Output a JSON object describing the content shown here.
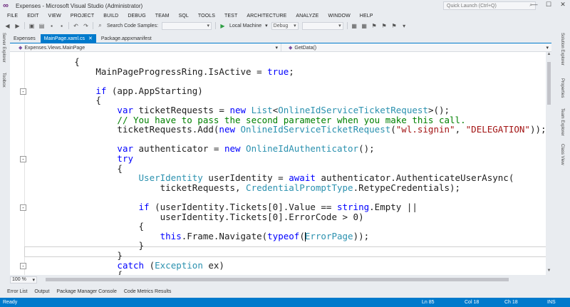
{
  "window": {
    "title": "Expenses - Microsoft Visual Studio (Administrator)",
    "quick_launch_placeholder": "Quick Launch (Ctrl+Q)",
    "min": "—",
    "max": "☐",
    "close": "✕"
  },
  "menu": [
    "FILE",
    "EDIT",
    "VIEW",
    "PROJECT",
    "BUILD",
    "DEBUG",
    "TEAM",
    "SQL",
    "TOOLS",
    "TEST",
    "ARCHITECTURE",
    "ANALYZE",
    "WINDOW",
    "HELP"
  ],
  "toolbar": {
    "search_code_samples": "Search Code Samples:",
    "run_target": "Local Machine",
    "configuration": "Debug"
  },
  "doc_tabs": [
    {
      "label": "Expenses",
      "active": false
    },
    {
      "label": "MainPage.xaml.cs",
      "active": true
    },
    {
      "label": "Package.appxmanifest",
      "active": false
    }
  ],
  "navbar": {
    "type_scope": "Expenses.Views.MainPage",
    "member_scope": "GetData()"
  },
  "side_tools": {
    "left": [
      "Server Explorer",
      "Toolbox"
    ],
    "right": [
      "Solution Explorer",
      "Properties",
      "Team Explorer",
      "Class View"
    ]
  },
  "code": {
    "lines": [
      {
        "indent": "        ",
        "parts": [
          {
            "t": "{",
            "c": ""
          }
        ]
      },
      {
        "indent": "            ",
        "parts": [
          {
            "t": "MainPageProgressRing.IsActive = ",
            "c": ""
          },
          {
            "t": "true",
            "c": "kw"
          },
          {
            "t": ";",
            "c": ""
          }
        ]
      },
      {
        "indent": "",
        "parts": [
          {
            "t": "",
            "c": ""
          }
        ]
      },
      {
        "indent": "            ",
        "parts": [
          {
            "t": "if",
            "c": "kw"
          },
          {
            "t": " (app.AppStarting)",
            "c": ""
          }
        ]
      },
      {
        "indent": "            ",
        "parts": [
          {
            "t": "{",
            "c": ""
          }
        ]
      },
      {
        "indent": "                ",
        "parts": [
          {
            "t": "var",
            "c": "kw"
          },
          {
            "t": " ticketRequests = ",
            "c": ""
          },
          {
            "t": "new",
            "c": "kw"
          },
          {
            "t": " ",
            "c": ""
          },
          {
            "t": "List",
            "c": "ty"
          },
          {
            "t": "<",
            "c": ""
          },
          {
            "t": "OnlineIdServiceTicketRequest",
            "c": "ty"
          },
          {
            "t": ">();",
            "c": ""
          }
        ]
      },
      {
        "indent": "                ",
        "parts": [
          {
            "t": "// You have to pass the second parameter when you make this call.",
            "c": "cm"
          }
        ]
      },
      {
        "indent": "                ",
        "parts": [
          {
            "t": "ticketRequests.Add(",
            "c": ""
          },
          {
            "t": "new",
            "c": "kw"
          },
          {
            "t": " ",
            "c": ""
          },
          {
            "t": "OnlineIdServiceTicketRequest",
            "c": "ty"
          },
          {
            "t": "(",
            "c": ""
          },
          {
            "t": "\"wl.signin\"",
            "c": "str"
          },
          {
            "t": ", ",
            "c": ""
          },
          {
            "t": "\"DELEGATION\"",
            "c": "str"
          },
          {
            "t": "));",
            "c": ""
          }
        ]
      },
      {
        "indent": "",
        "parts": [
          {
            "t": "",
            "c": ""
          }
        ]
      },
      {
        "indent": "                ",
        "parts": [
          {
            "t": "var",
            "c": "kw"
          },
          {
            "t": " authenticator = ",
            "c": ""
          },
          {
            "t": "new",
            "c": "kw"
          },
          {
            "t": " ",
            "c": ""
          },
          {
            "t": "OnlineIdAuthenticator",
            "c": "ty"
          },
          {
            "t": "();",
            "c": ""
          }
        ]
      },
      {
        "indent": "                ",
        "parts": [
          {
            "t": "try",
            "c": "kw"
          }
        ]
      },
      {
        "indent": "                ",
        "parts": [
          {
            "t": "{",
            "c": ""
          }
        ]
      },
      {
        "indent": "                    ",
        "parts": [
          {
            "t": "UserIdentity",
            "c": "ty"
          },
          {
            "t": " userIdentity = ",
            "c": ""
          },
          {
            "t": "await",
            "c": "kw"
          },
          {
            "t": " authenticator.AuthenticateUserAsync(",
            "c": ""
          }
        ]
      },
      {
        "indent": "                        ",
        "parts": [
          {
            "t": "ticketRequests, ",
            "c": ""
          },
          {
            "t": "CredentialPromptType",
            "c": "ty"
          },
          {
            "t": ".RetypeCredentials);",
            "c": ""
          }
        ]
      },
      {
        "indent": "",
        "parts": [
          {
            "t": "",
            "c": ""
          }
        ]
      },
      {
        "indent": "                    ",
        "parts": [
          {
            "t": "if",
            "c": "kw"
          },
          {
            "t": " (userIdentity.Tickets[0].Value == ",
            "c": ""
          },
          {
            "t": "string",
            "c": "kw"
          },
          {
            "t": ".Empty ||",
            "c": ""
          }
        ]
      },
      {
        "indent": "                        ",
        "parts": [
          {
            "t": "userIdentity.Tickets[0].ErrorCode > 0)",
            "c": ""
          }
        ]
      },
      {
        "indent": "                    ",
        "parts": [
          {
            "t": "{",
            "c": ""
          }
        ]
      },
      {
        "indent": "                        ",
        "parts": [
          {
            "t": "this",
            "c": "kw"
          },
          {
            "t": ".Frame.Navigate(",
            "c": ""
          },
          {
            "t": "typeof",
            "c": "kw"
          },
          {
            "t": "(",
            "c": ""
          },
          {
            "t": "CARET",
            "c": "caret"
          },
          {
            "t": "ErrorPage",
            "c": "ty"
          },
          {
            "t": "));",
            "c": ""
          }
        ]
      },
      {
        "indent": "                    ",
        "parts": [
          {
            "t": "}",
            "c": ""
          }
        ]
      },
      {
        "indent": "                ",
        "parts": [
          {
            "t": "}",
            "c": ""
          }
        ]
      },
      {
        "indent": "                ",
        "parts": [
          {
            "t": "catch",
            "c": "kw"
          },
          {
            "t": " (",
            "c": ""
          },
          {
            "t": "Exception",
            "c": "ty"
          },
          {
            "t": " ex)",
            "c": ""
          }
        ]
      },
      {
        "indent": "                ",
        "parts": [
          {
            "t": "{",
            "c": ""
          }
        ]
      }
    ],
    "collapse_markers": [
      {
        "line": 3,
        "glyph": "-"
      },
      {
        "line": 10,
        "glyph": "-"
      },
      {
        "line": 15,
        "glyph": "-"
      },
      {
        "line": 21,
        "glyph": "-"
      }
    ]
  },
  "editor_bottom": {
    "zoom": "100 %"
  },
  "bottom_tabs": [
    "Error List",
    "Output",
    "Package Manager Console",
    "Code Metrics Results"
  ],
  "status": {
    "left": "Ready",
    "ln": "Ln 85",
    "col": "Col 18",
    "ch": "Ch 18",
    "mode": "INS"
  }
}
